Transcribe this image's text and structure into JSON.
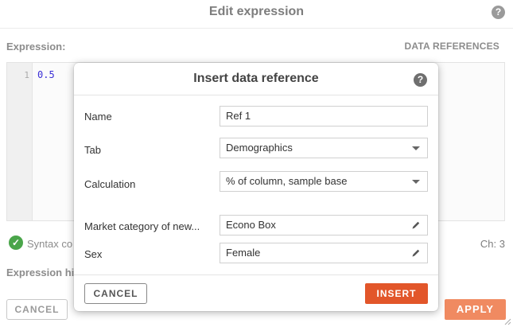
{
  "editor": {
    "title": "Edit expression",
    "help_glyph": "?",
    "expression_label": "Expression:",
    "data_references_label": "DATA REFERENCES",
    "line_number": "1",
    "code": "0.5",
    "syntax_text": "Syntax co",
    "char_count": "Ch:  3",
    "expression_hint_label": "Expression hi",
    "cancel_label": "CANCEL",
    "apply_label": "APPLY"
  },
  "modal": {
    "title": "Insert data reference",
    "help_glyph": "?",
    "fields": {
      "name_label": "Name",
      "name_value": "Ref 1",
      "tab_label": "Tab",
      "tab_value": "Demographics",
      "calc_label": "Calculation",
      "calc_value": "% of column, sample base",
      "market_label": "Market category of new...",
      "market_value": "Econo Box",
      "sex_label": "Sex",
      "sex_value": "Female"
    },
    "cancel_label": "CANCEL",
    "insert_label": "INSERT"
  },
  "colors": {
    "accent": "#e2562a",
    "accent_disabled": "#f08a61",
    "success": "#4aa54a",
    "code": "#3b2fd6"
  },
  "icons": [
    "help-icon",
    "check-circle-icon",
    "pencil-icon",
    "chevron-down-icon",
    "resize-grip-icon"
  ]
}
